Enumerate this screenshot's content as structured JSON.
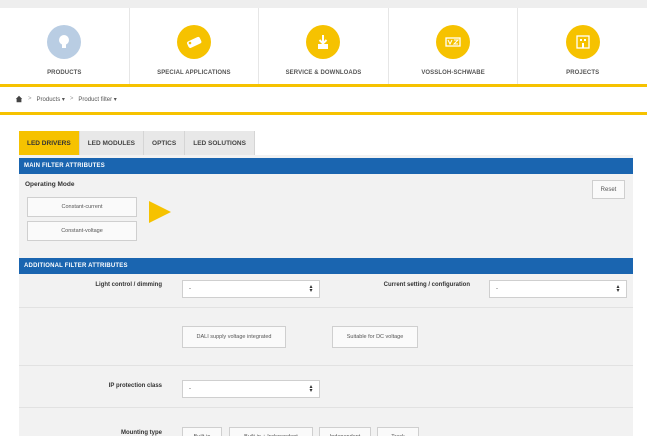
{
  "nav": {
    "items": [
      {
        "label": "PRODUCTS",
        "icon": "lightbulb-icon",
        "color": "#b9cde3"
      },
      {
        "label": "SPECIAL APPLICATIONS",
        "icon": "tag-icon",
        "color": "#f6c200"
      },
      {
        "label": "SERVICE & DOWNLOADS",
        "icon": "download-icon",
        "color": "#f6c200"
      },
      {
        "label": "VOSSLOH-SCHWABE",
        "icon": "vs-logo-icon",
        "color": "#f6c200"
      },
      {
        "label": "PROJECTS",
        "icon": "building-icon",
        "color": "#f6c200"
      }
    ]
  },
  "breadcrumb": {
    "separator": ">",
    "items": [
      "Products ▾",
      "Product filter ▾"
    ]
  },
  "tabs": [
    {
      "label": "LED DRIVERS",
      "active": true
    },
    {
      "label": "LED MODULES",
      "active": false
    },
    {
      "label": "OPTICS",
      "active": false
    },
    {
      "label": "LED SOLUTIONS",
      "active": false
    }
  ],
  "main_filter": {
    "title": "MAIN FILTER ATTRIBUTES",
    "operating_mode_label": "Operating Mode",
    "buttons": [
      "Constant-current",
      "Constant-voltage"
    ],
    "reset_label": "Reset"
  },
  "additional_filter": {
    "title": "ADDITIONAL FILTER ATTRIBUTES",
    "light_control_label": "Light control / dimming",
    "light_control_value": "-",
    "current_setting_label": "Current setting / configuration",
    "current_setting_value": "-",
    "feature_buttons": [
      "DALI supply voltage integrated",
      "Suitable for DC voltage"
    ],
    "ip_label": "IP protection class",
    "ip_value": "-",
    "mounting_label": "Mounting type",
    "mounting_buttons": [
      "Built-in",
      "Built-in + Independent",
      "Independent",
      "Track"
    ]
  },
  "colors": {
    "accent": "#f6c200",
    "section_bar": "#1a65b0"
  }
}
